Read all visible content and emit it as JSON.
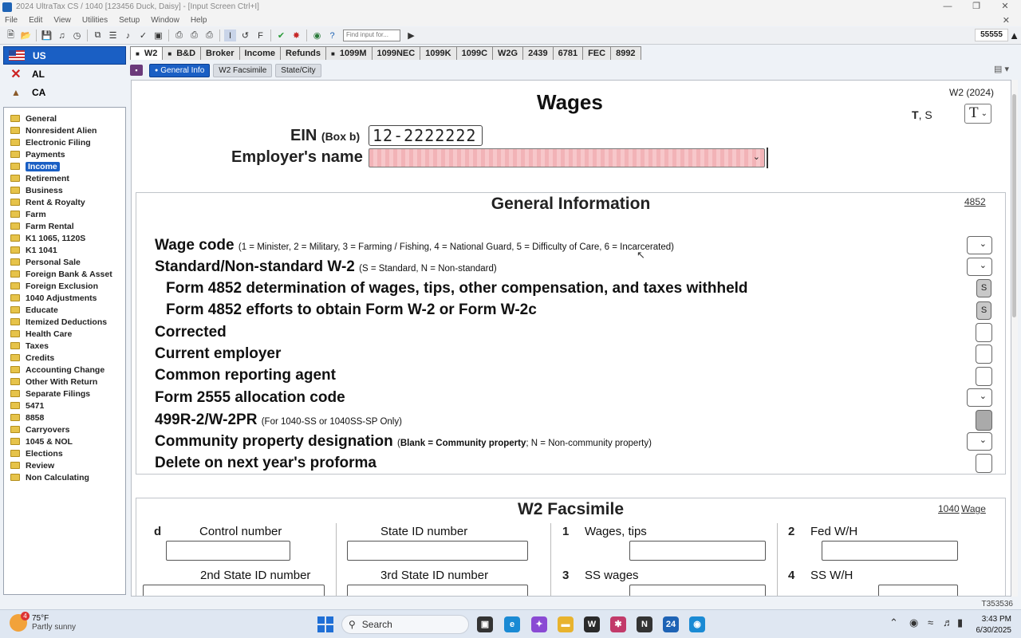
{
  "window": {
    "title": "2024 UltraTax CS  / 1040 [123456 Duck, Daisy] - [Input Screen    Ctrl+I]"
  },
  "menu": [
    "File",
    "Edit",
    "View",
    "Utilities",
    "Setup",
    "Window",
    "Help"
  ],
  "toolbar": {
    "find_placeholder": "Find input for...",
    "return_id": "55555"
  },
  "states": [
    {
      "code": "US"
    },
    {
      "code": "AL"
    },
    {
      "code": "CA"
    }
  ],
  "categories": [
    "General",
    "Nonresident Alien",
    "Electronic Filing",
    "Payments",
    "Income",
    "Retirement",
    "Business",
    "Rent & Royalty",
    "Farm",
    "Farm Rental",
    "K1 1065, 1120S",
    "K1 1041",
    "Personal Sale",
    "Foreign Bank & Asset",
    "Foreign Exclusion",
    "1040 Adjustments",
    "Educate",
    "Itemized Deductions",
    "Health Care",
    "Taxes",
    "Credits",
    "Accounting Change",
    "Other With Return",
    "Separate Filings",
    "5471",
    "8858",
    "Carryovers",
    "1045 & NOL",
    "Elections",
    "Review",
    "Non Calculating"
  ],
  "active_category": "Income",
  "tabs": [
    "W2",
    "B&D",
    "Broker",
    "Income",
    "Refunds",
    "1099M",
    "1099NEC",
    "1099K",
    "1099C",
    "W2G",
    "2439",
    "6781",
    "FEC",
    "8992"
  ],
  "subtabs": [
    "General Info",
    "W2 Facsimile",
    "State/City"
  ],
  "form": {
    "title": "Wages",
    "form_year": "W2 (2024)",
    "ts_label": "T",
    "ts_label2": ", S",
    "ts_value": "T",
    "ein_label": "EIN",
    "ein_box": "(Box b)",
    "ein_value": "12-2222222",
    "employer_label": "Employer's name",
    "employer_value": ""
  },
  "general_info": {
    "title": "General Information",
    "link": "4852",
    "wage_code": {
      "label": "Wage code",
      "note": "(1 = Minister, 2 = Military, 3 = Farming / Fishing, 4 = National Guard, 5 = Difficulty of Care, 6 = Incarcerated)"
    },
    "standard": {
      "label": "Standard/Non-standard W-2",
      "note": "(S = Standard, N = Non-standard)"
    },
    "f4852_wages": {
      "label": "Form 4852 determination of wages, tips, other compensation, and taxes withheld",
      "btn": "S"
    },
    "f4852_efforts": {
      "label": "Form 4852 efforts to obtain Form W-2 or Form W-2c",
      "btn": "S"
    },
    "corrected": {
      "label": "Corrected"
    },
    "current_employer": {
      "label": "Current employer"
    },
    "common_agent": {
      "label": "Common reporting agent"
    },
    "f2555": {
      "label": "Form 2555 allocation code"
    },
    "w2pr": {
      "label": "499R-2/W-2PR",
      "note": "(For 1040-SS or 1040SS-SP Only)"
    },
    "community": {
      "label": "Community property designation",
      "note_bold": "Blank = Community property",
      "note_rest": "; N = Non-community property)",
      "note_open": "("
    },
    "delete": {
      "label": "Delete on next year's proforma"
    }
  },
  "facsimile": {
    "title": "W2 Facsimile",
    "link1": "1040",
    "link2": "Wage",
    "d": "d",
    "control": "Control number",
    "state_id": "State ID number",
    "n1": "1",
    "wages": "Wages, tips",
    "n2": "2",
    "fed": "Fed W/H",
    "state_id2": "2nd State ID number",
    "state_id3": "3rd State ID number",
    "n3": "3",
    "ss_wages": "SS wages",
    "n4": "4",
    "ss_wh": "SS W/H"
  },
  "status": {
    "right": "T353536"
  },
  "taskbar": {
    "weather_temp": "75°F",
    "weather_desc": "Partly sunny",
    "weather_badge": "4",
    "search": "Search",
    "time": "3:43 PM",
    "date": "6/30/2025"
  }
}
